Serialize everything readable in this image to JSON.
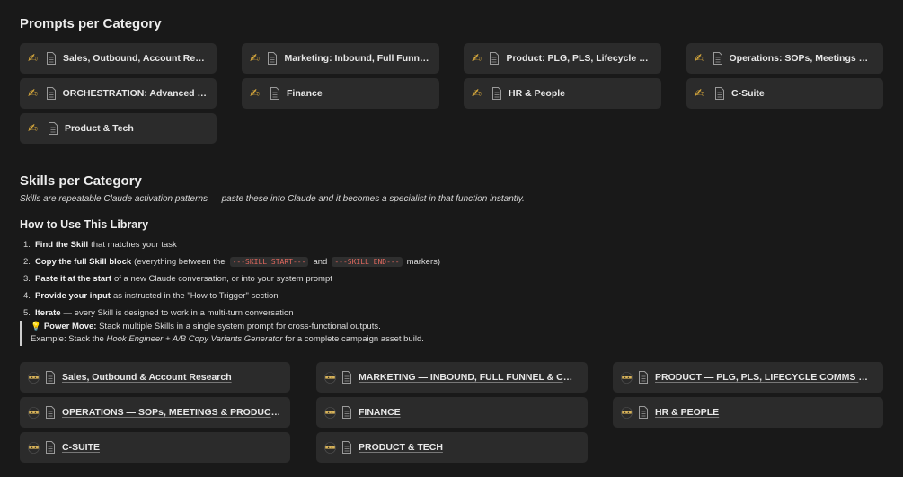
{
  "prompts_heading": "Prompts per Category",
  "prompt_icon": "writing-hand-icon",
  "prompts": [
    {
      "label": "Sales, Outbound, Account Research"
    },
    {
      "label": "Marketing: Inbound, Full Funnel & C..."
    },
    {
      "label": "Product: PLG, PLS, Lifecycle Comm..."
    },
    {
      "label": "Operations: SOPs, Meetings & Prod..."
    },
    {
      "label": "ORCHESTRATION: Advanced Multi-..."
    },
    {
      "label": "Finance"
    },
    {
      "label": "HR & People"
    },
    {
      "label": "C-Suite"
    },
    {
      "label": "Product & Tech"
    }
  ],
  "skills_heading": "Skills per Category",
  "skills_intro": "Skills are repeatable Claude activation patterns — paste these into Claude and it becomes a specialist in that function instantly.",
  "howto_heading": "How to Use This Library",
  "steps": [
    {
      "num": "1.",
      "bold": "Find the Skill",
      "text": "that matches your task"
    },
    {
      "num": "2.",
      "bold": "Copy the full Skill block",
      "text_a": "(everything between the",
      "code1": "---SKILL START---",
      "mid": "and",
      "code2": "---SKILL END---",
      "text_b": "markers)"
    },
    {
      "num": "3.",
      "bold": "Paste it at the start",
      "text": "of a new Claude conversation, or into your system prompt"
    },
    {
      "num": "4.",
      "bold": "Provide your input",
      "text": "as instructed in the \"How to Trigger\" section"
    },
    {
      "num": "5.",
      "bold": "Iterate",
      "text": "— every Skill is designed to work in a multi-turn conversation"
    }
  ],
  "callout": {
    "icon": "lightbulb-icon",
    "bold": "Power Move:",
    "line1": "Stack multiple Skills in a single system prompt for cross-functional outputs.",
    "example_prefix": "Example: Stack the",
    "example_italic": "Hook Engineer + A/B Copy Variants Generator",
    "example_suffix": "for a complete campaign asset build."
  },
  "skill_icon": "ninja-icon",
  "skills": [
    {
      "label": "Sales, Outbound & Account Research"
    },
    {
      "label": "MARKETING — INBOUND, FULL FUNNEL & CAMPAIGNS"
    },
    {
      "label": "PRODUCT — PLG, PLS, LIFECYCLE COMMS & GROWTH"
    },
    {
      "label": "OPERATIONS — SOPs, MEETINGS & PRODUCTIVITY"
    },
    {
      "label": "FINANCE"
    },
    {
      "label": "HR & PEOPLE"
    },
    {
      "label": "C-SUITE"
    },
    {
      "label": "PRODUCT & TECH"
    }
  ],
  "colors": {
    "background": "#191919",
    "card": "#2b2b2b",
    "code": "#e0685e"
  }
}
